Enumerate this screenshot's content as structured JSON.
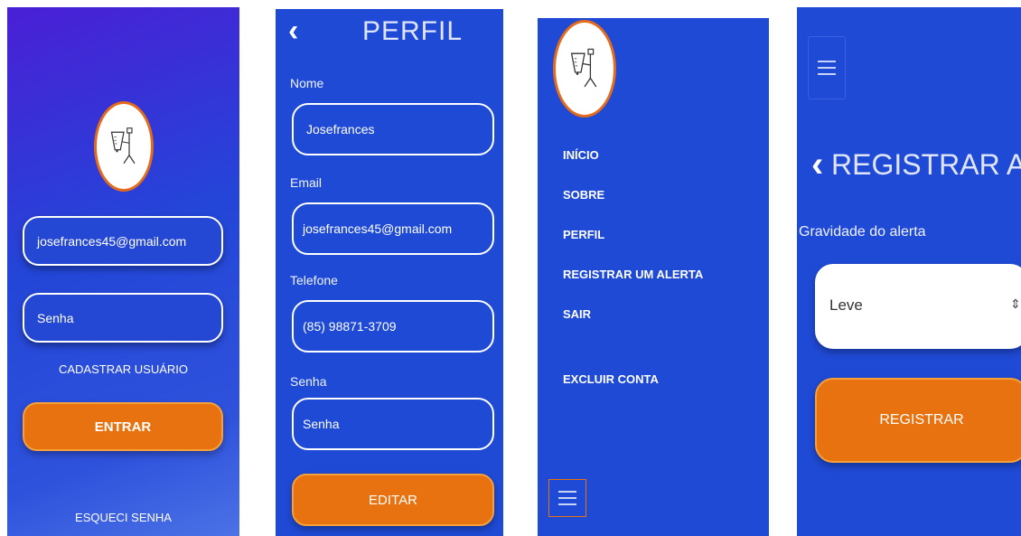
{
  "login": {
    "email_value": "josefrances45@gmail.com",
    "password_placeholder": "Senha",
    "register_link": "CADASTRAR USUÁRIO",
    "enter_button": "ENTRAR",
    "forgot_link": "ESQUECI SENHA"
  },
  "profile": {
    "back_glyph": "‹",
    "title": "PERFIL",
    "name_label": "Nome",
    "name_value": "Josefrances",
    "email_label": "Email",
    "email_value": "josefrances45@gmail.com",
    "phone_label": "Telefone",
    "phone_value": "(85) 98871-3709",
    "password_label": "Senha",
    "password_placeholder": "Senha",
    "edit_button": "EDITAR"
  },
  "menu": {
    "items": [
      {
        "label": "INÍCIO"
      },
      {
        "label": "SOBRE"
      },
      {
        "label": "PERFIL"
      },
      {
        "label": "REGISTRAR UM ALERTA"
      },
      {
        "label": "SAIR"
      },
      {
        "label": "EXCLUIR CONTA"
      }
    ]
  },
  "alert": {
    "back_glyph": "‹",
    "title": "REGISTRAR ALERTA",
    "severity_label": "Gravidade do alerta",
    "severity_value": "Leve",
    "select_arrow": "⇕",
    "register_button": "REGISTRAR"
  },
  "icons": [
    "app-logo-icon",
    "back-icon",
    "hamburger-menu-icon",
    "select-arrow-icon"
  ],
  "colors": {
    "background_blue": "#1f4ad5",
    "accent_orange": "#e8720f",
    "logo_border": "#e46b1c"
  }
}
